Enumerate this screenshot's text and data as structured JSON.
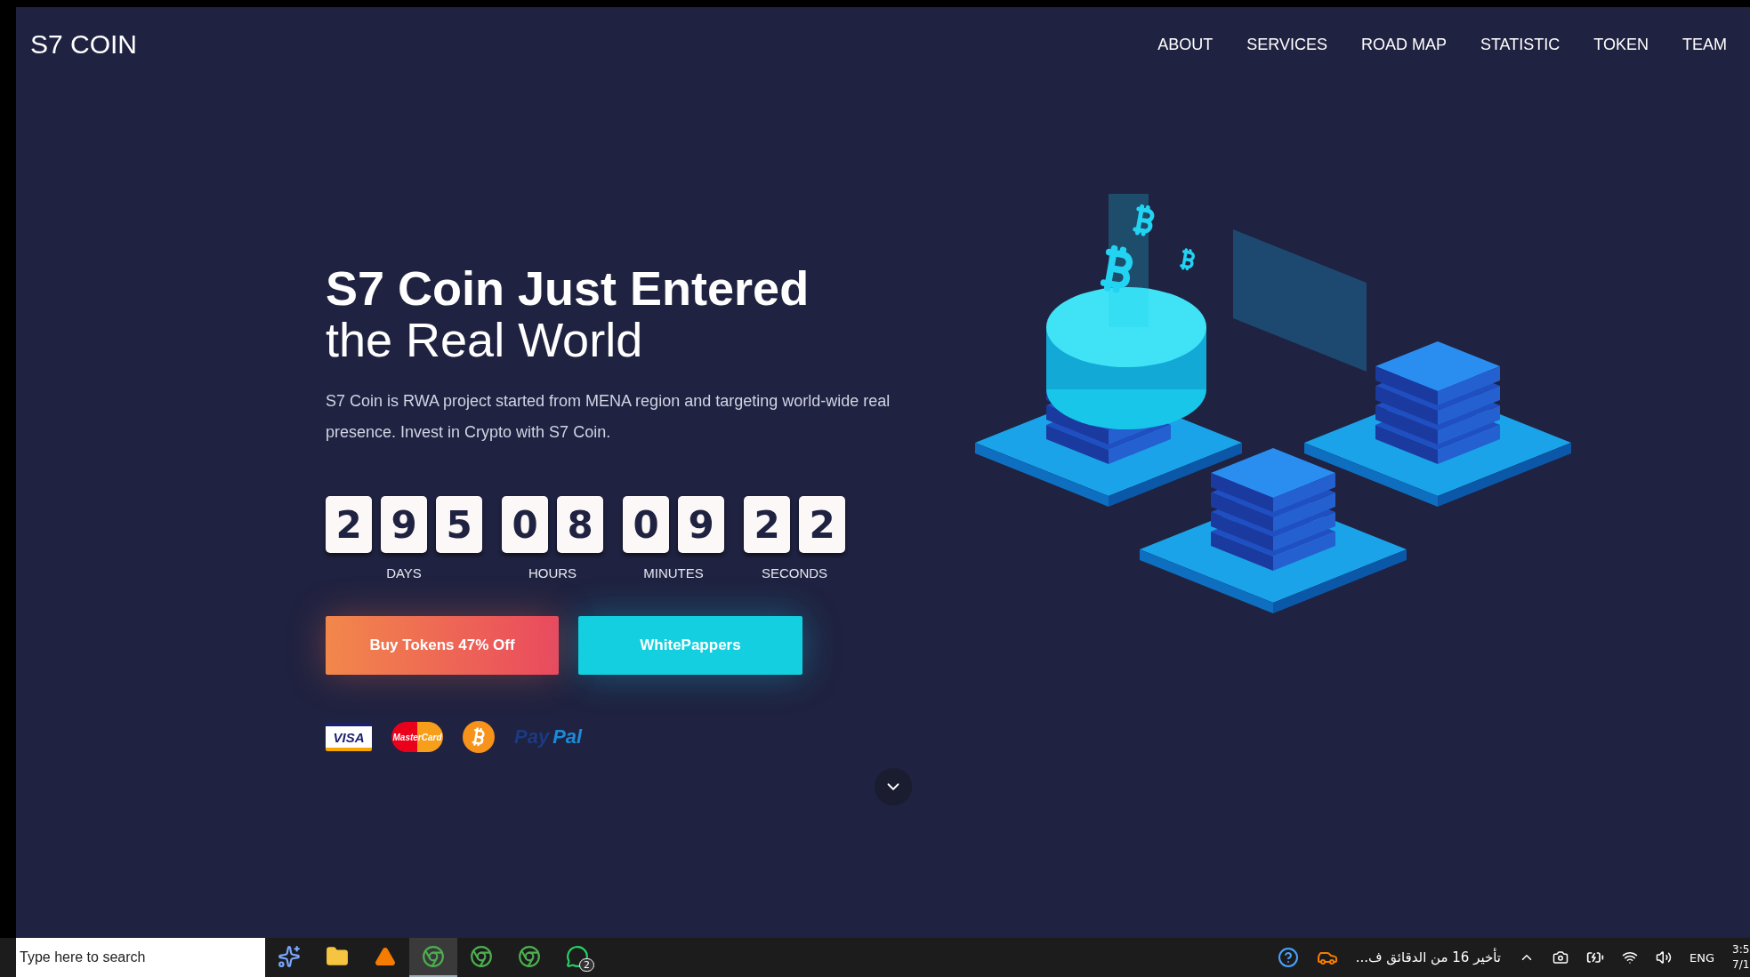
{
  "brand": "S7 COIN",
  "nav": [
    "ABOUT",
    "SERVICES",
    "ROAD MAP",
    "STATISTIC",
    "TOKEN",
    "TEAM"
  ],
  "hero": {
    "title_bold": "S7 Coin Just Entered",
    "title_light": "the Real World",
    "description": "S7 Coin is RWA project started from MENA region and targeting world-wide real presence. Invest in Crypto with S7 Coin."
  },
  "countdown": [
    {
      "digits": [
        "2",
        "9",
        "5"
      ],
      "label": "DAYS"
    },
    {
      "digits": [
        "0",
        "8"
      ],
      "label": "HOURS"
    },
    {
      "digits": [
        "0",
        "9"
      ],
      "label": "MINUTES"
    },
    {
      "digits": [
        "2",
        "2"
      ],
      "label": "SECONDS"
    }
  ],
  "buttons": [
    {
      "kind": "primary",
      "label": "Buy Tokens 47% Off"
    },
    {
      "kind": "secondary",
      "label": "WhitePappers"
    }
  ],
  "payments": [
    {
      "kind": "visa",
      "label": "VISA"
    },
    {
      "kind": "mastercard",
      "label": "MasterCard"
    },
    {
      "kind": "bitcoin"
    },
    {
      "kind": "paypal",
      "label_a": "Pay",
      "label_b": "Pal"
    }
  ],
  "taskbar": {
    "search_placeholder": "Type here to search",
    "apps": [
      {
        "kind": "copilot"
      },
      {
        "kind": "folder"
      },
      {
        "kind": "cone"
      },
      {
        "kind": "browser",
        "selected": true
      },
      {
        "kind": "browser",
        "selected": false
      },
      {
        "kind": "browser",
        "selected": false
      },
      {
        "kind": "chat",
        "badge": "2"
      }
    ],
    "notification": "تأخير 16 من الدقائق ف...",
    "language": "ENG",
    "time": "3:5",
    "date": "7/1"
  }
}
